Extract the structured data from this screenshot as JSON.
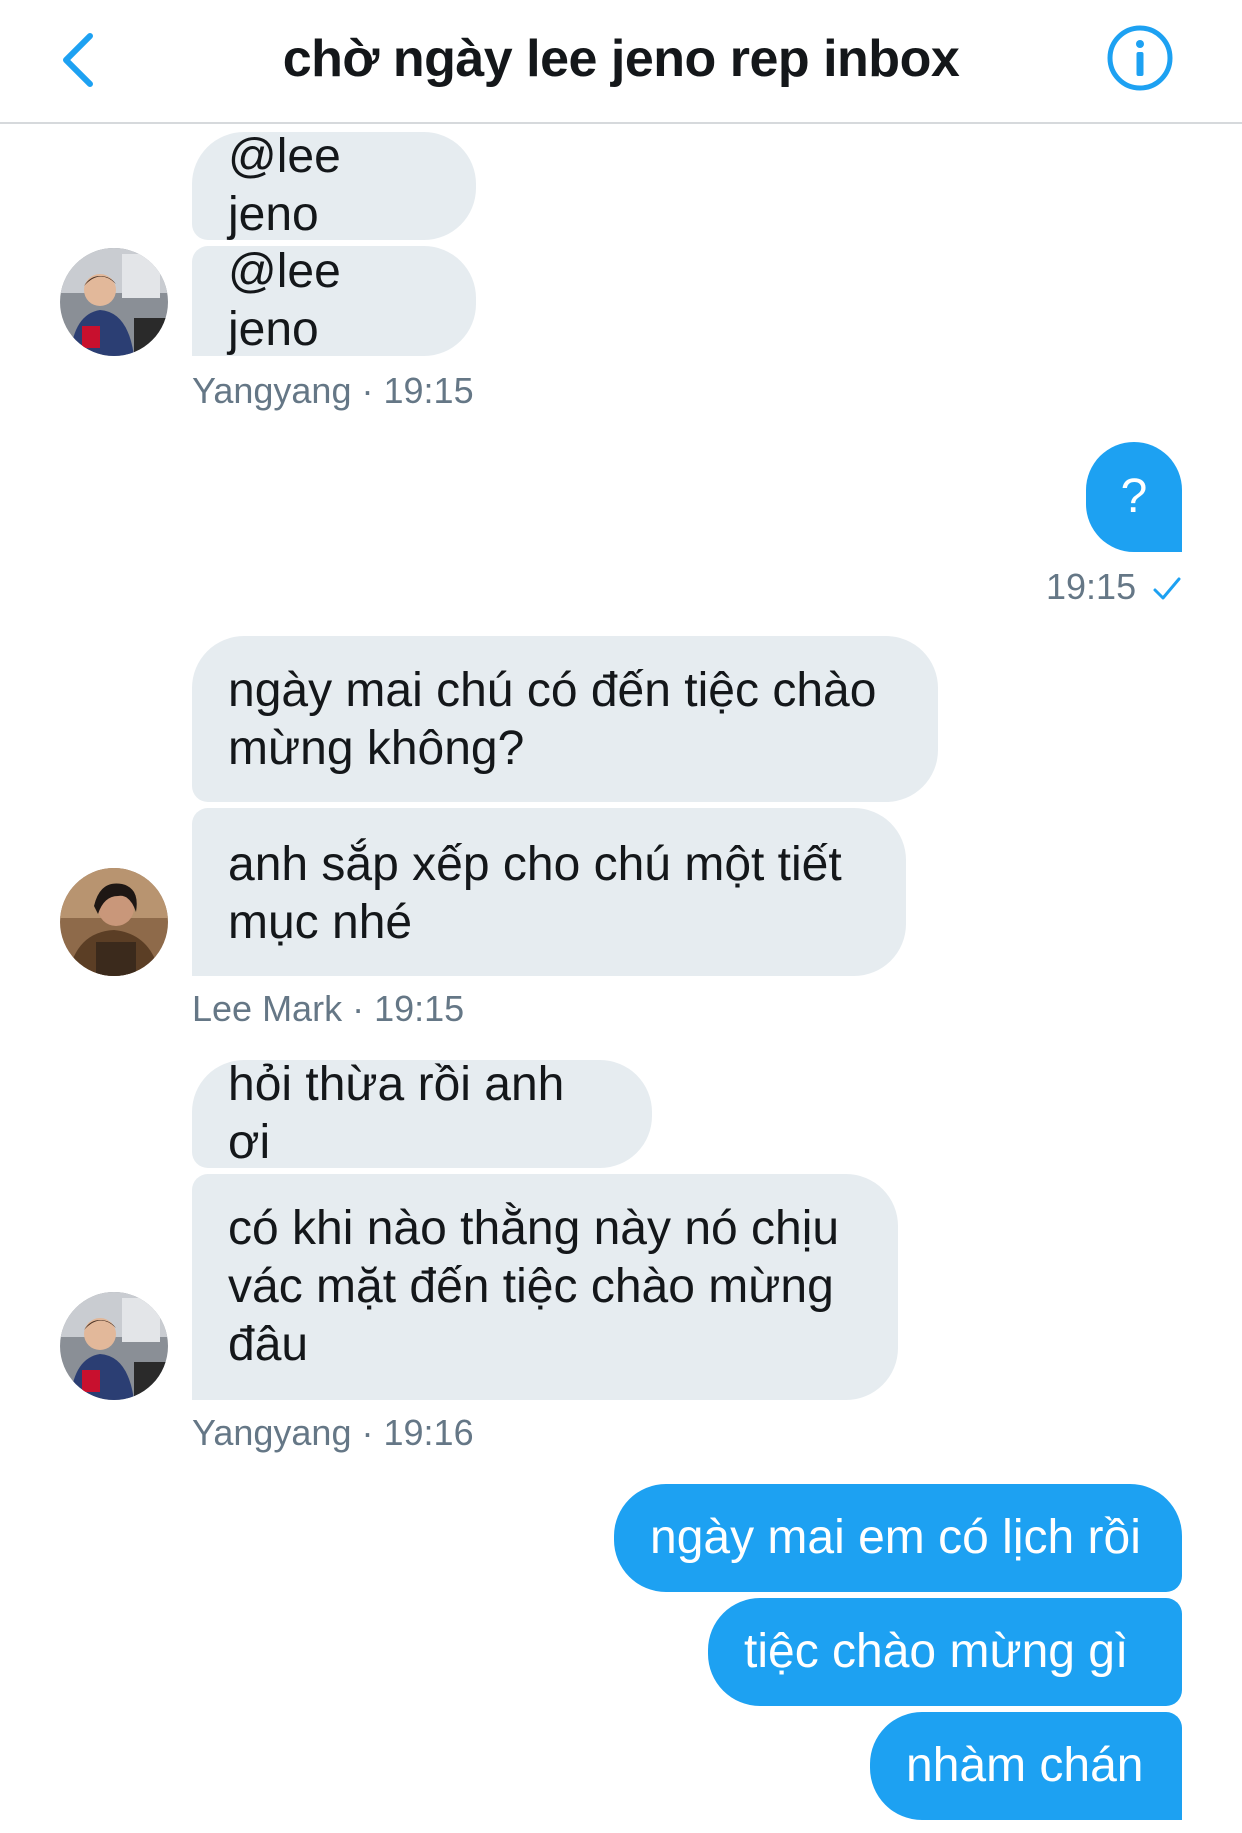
{
  "header": {
    "title": "chờ ngày lee jeno rep inbox",
    "back_icon": "chevron-left-icon",
    "info_icon": "info-circle-icon"
  },
  "colors": {
    "accent": "#1da1f2",
    "incoming_bubble": "#e6ecf0",
    "meta_text": "#657786"
  },
  "messages": {
    "g1_m1": "@lee jeno",
    "g1_m2": "@lee jeno",
    "g1_sender": "Yangyang",
    "g1_time": "19:15",
    "me1": "?",
    "me1_time": "19:15",
    "g2_m1_l1": "ngày mai chú có đến tiệc chào",
    "g2_m1_l2": "mừng không?",
    "g2_m2_l1": "anh sắp xếp cho chú một tiết",
    "g2_m2_l2": "mục nhé",
    "g2_sender": "Lee Mark",
    "g2_time": "19:15",
    "g3_m1": "hỏi thừa rồi anh ơi",
    "g3_m2_l1": "có khi nào thằng này nó chịu",
    "g3_m2_l2": "vác mặt đến tiệc chào mừng",
    "g3_m2_l3": "đâu",
    "g3_sender": "Yangyang",
    "g3_time": "19:16",
    "me2_m1": "ngày mai em có lịch rồi",
    "me2_m2": "tiệc chào mừng gì",
    "me2_m3": "nhàm chán"
  },
  "separator": "·"
}
